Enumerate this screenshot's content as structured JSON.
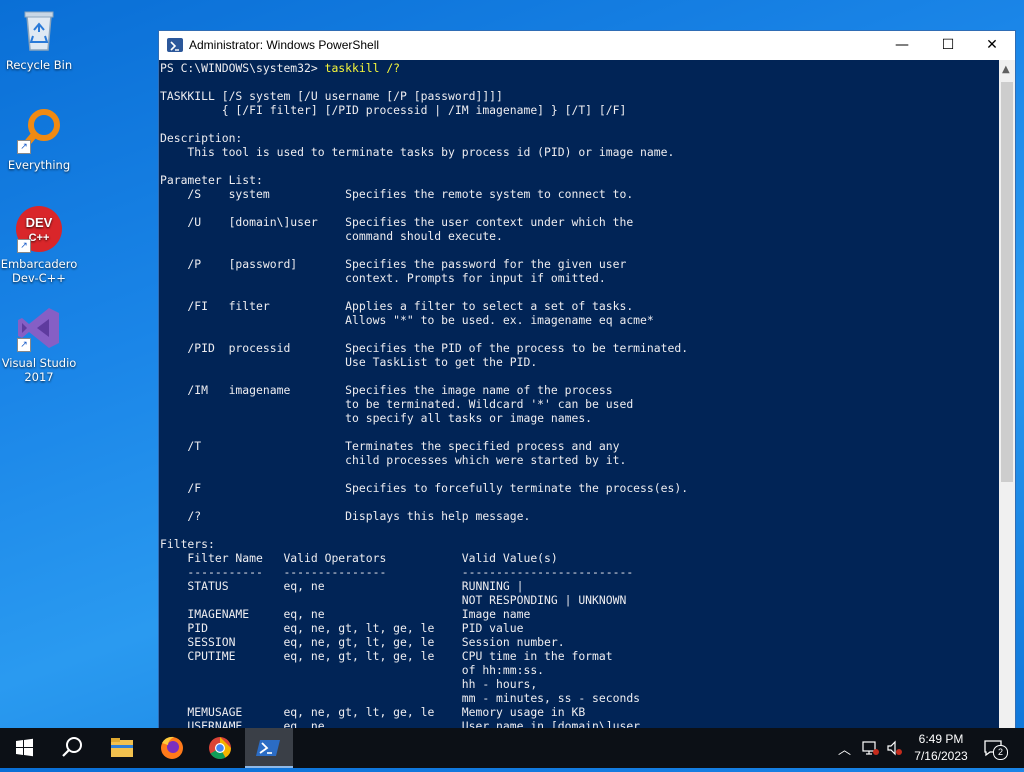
{
  "desktop": {
    "icons": [
      {
        "label": "Recycle Bin",
        "icon": "recycle-bin-icon"
      },
      {
        "label": "Everything",
        "icon": "everything-search-icon"
      },
      {
        "label": "Embarcadero Dev-C++",
        "line1": "Embarcadero",
        "line2": "Dev-C++",
        "icon": "devcpp-icon",
        "logo_text": "DEV C++"
      },
      {
        "label": "Visual Studio 2017",
        "line1": "Visual Studio",
        "line2": "2017",
        "icon": "visual-studio-icon"
      }
    ]
  },
  "window": {
    "title": "Administrator: Windows PowerShell",
    "minimize": "—",
    "maximize": "☐",
    "close": "✕"
  },
  "console": {
    "prompt": "PS C:\\WINDOWS\\system32> ",
    "command": "taskkill /?",
    "output": "\nTASKKILL [/S system [/U username [/P [password]]]]\n         { [/FI filter] [/PID processid | /IM imagename] } [/T] [/F]\n\nDescription:\n    This tool is used to terminate tasks by process id (PID) or image name.\n\nParameter List:\n    /S    system           Specifies the remote system to connect to.\n\n    /U    [domain\\]user    Specifies the user context under which the\n                           command should execute.\n\n    /P    [password]       Specifies the password for the given user\n                           context. Prompts for input if omitted.\n\n    /FI   filter           Applies a filter to select a set of tasks.\n                           Allows \"*\" to be used. ex. imagename eq acme*\n\n    /PID  processid        Specifies the PID of the process to be terminated.\n                           Use TaskList to get the PID.\n\n    /IM   imagename        Specifies the image name of the process\n                           to be terminated. Wildcard '*' can be used\n                           to specify all tasks or image names.\n\n    /T                     Terminates the specified process and any\n                           child processes which were started by it.\n\n    /F                     Specifies to forcefully terminate the process(es).\n\n    /?                     Displays this help message.\n\nFilters:\n    Filter Name   Valid Operators           Valid Value(s)\n    -----------   ---------------           -------------------------\n    STATUS        eq, ne                    RUNNING |\n                                            NOT RESPONDING | UNKNOWN\n    IMAGENAME     eq, ne                    Image name\n    PID           eq, ne, gt, lt, ge, le    PID value\n    SESSION       eq, ne, gt, lt, ge, le    Session number.\n    CPUTIME       eq, ne, gt, lt, ge, le    CPU time in the format\n                                            of hh:mm:ss.\n                                            hh - hours,\n                                            mm - minutes, ss - seconds\n    MEMUSAGE      eq, ne, gt, lt, ge, le    Memory usage in KB\n    USERNAME      eq, ne                    User name in [domain\\]user\n                                            format"
  },
  "taskbar": {
    "items": [
      "start-icon",
      "search-icon",
      "file-explorer-icon",
      "firefox-icon",
      "chrome-icon",
      "powershell-icon"
    ],
    "active": "powershell-icon",
    "tray": {
      "time": "6:49 PM",
      "date": "7/16/2023",
      "notifications": "2"
    }
  },
  "colors": {
    "console_bg": "#012456",
    "console_fg": "#eeedf0",
    "command": "#f7f73a",
    "taskbar": "#0c1016"
  }
}
